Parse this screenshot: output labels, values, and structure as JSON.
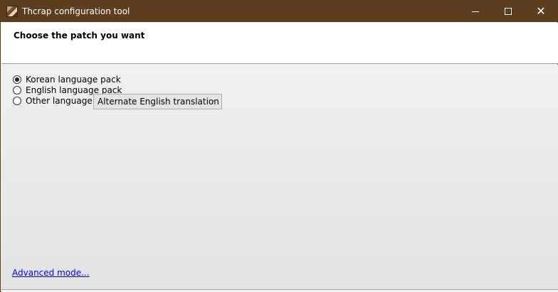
{
  "window": {
    "title": "Thcrap configuration tool",
    "icon": "thcrap-app-icon",
    "controls": {
      "minimize": "minimize-icon",
      "maximize": "maximize-icon",
      "close_glyph": "✕"
    }
  },
  "header": {
    "title": "Choose the patch you want"
  },
  "options": {
    "korean": {
      "label": "Korean language pack",
      "checked": true
    },
    "english": {
      "label": "English language pack",
      "checked": false
    },
    "other": {
      "label": "Other language:",
      "checked": false
    }
  },
  "language_select": {
    "value": "Alternate English translation",
    "chevron": "⌄"
  },
  "footer": {
    "advanced_link": "Advanced mode..."
  },
  "colors": {
    "titlebar": "#5c3d1e",
    "link": "#0000ee"
  }
}
